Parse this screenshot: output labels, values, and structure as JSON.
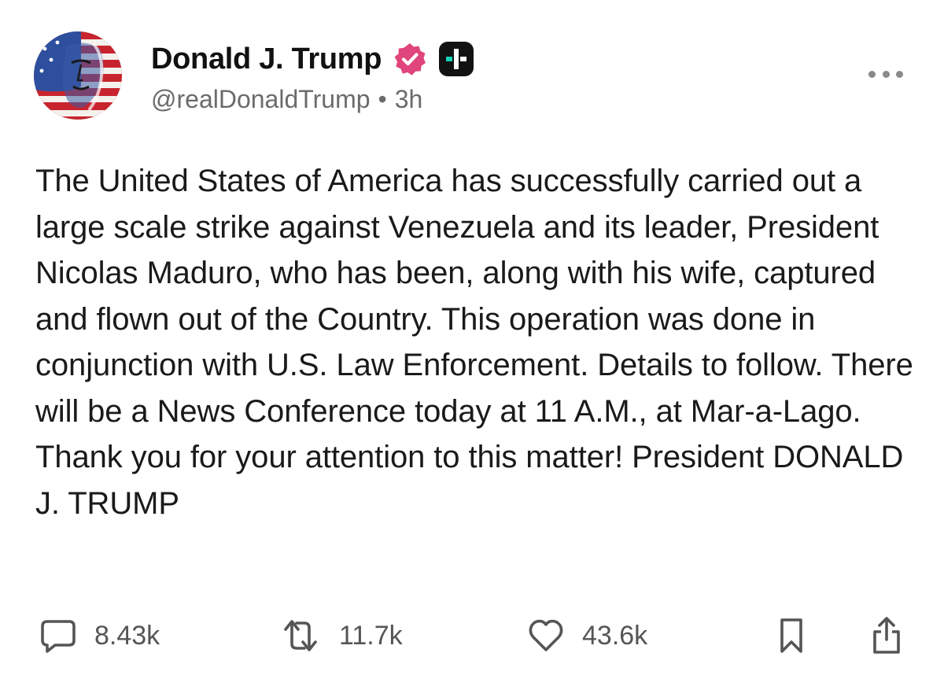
{
  "author": {
    "display_name": "Donald J. Trump",
    "handle": "@realDonaldTrump",
    "separator": "•",
    "time_ago": "3h",
    "verified_badge_icon": "verified-badge-icon",
    "verified_color": "#e0457b",
    "plus_badge_icon": "plus-badge-icon"
  },
  "post": {
    "text": "The United States of America has successfully carried out a large scale strike against Venezuela and its leader, President Nicolas Maduro, who has been, along with his wife, captured and flown out of the Country. This operation was done in conjunction with U.S. Law Enforcement. Details to follow. There will be a News Conference today at 11 A.M., at Mar-a-Lago. Thank you for your attention to this matter! President DONALD J. TRUMP"
  },
  "actions": {
    "replies": "8.43k",
    "retruths": "11.7k",
    "likes": "43.6k"
  },
  "icons": {
    "more": "more-options-icon",
    "reply": "reply-icon",
    "retruth": "retruth-icon",
    "like": "heart-icon",
    "bookmark": "bookmark-icon",
    "share": "share-icon"
  }
}
